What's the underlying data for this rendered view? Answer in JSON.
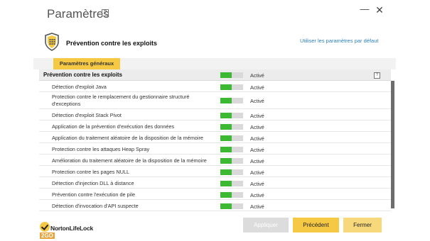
{
  "window": {
    "title": "Paramètres",
    "help": "?",
    "minimize": "—",
    "close": "✕"
  },
  "section": {
    "title": "Prévention contre les exploits",
    "icon": "shield-icon",
    "defaults_link": "Utiliser les paramètres par défaut"
  },
  "tab": {
    "label": "Paramètres généraux"
  },
  "colors": {
    "accent": "#f6c944",
    "toggle_on": "#3cb832",
    "link": "#2f7fb8"
  },
  "list": {
    "header": {
      "label": "Prévention contre les exploits",
      "status": "Activé",
      "enabled": true,
      "help": "?"
    },
    "rows": [
      {
        "label": "Détection d'exploit Java",
        "status": "Activé",
        "enabled": true
      },
      {
        "label": "Protection contre le remplacement du gestionnaire structuré d'exceptions",
        "status": "Activé",
        "enabled": true
      },
      {
        "label": "Détection d'exploit Stack Pivot",
        "status": "Activé",
        "enabled": true
      },
      {
        "label": "Application de la prévention d'exécution des données",
        "status": "Activé",
        "enabled": true
      },
      {
        "label": "Application du traitement aléatoire de la disposition de la mémoire",
        "status": "Activé",
        "enabled": true
      },
      {
        "label": "Protection contre les attaques Heap Spray",
        "status": "Activé",
        "enabled": true
      },
      {
        "label": "Amélioration du traitement aléatoire de la disposition de la mémoire",
        "status": "Activé",
        "enabled": true
      },
      {
        "label": "Protection contre les pages NULL",
        "status": "Activé",
        "enabled": true
      },
      {
        "label": "Détection d'injection DLL à distance",
        "status": "Activé",
        "enabled": true
      },
      {
        "label": "Prévention contre l'exécution de pile",
        "status": "Activé",
        "enabled": true
      },
      {
        "label": "Détection d'invocation d'API suspecte",
        "status": "Activé",
        "enabled": true
      }
    ]
  },
  "footer": {
    "logo": {
      "name": "NortonLifeLock",
      "suffix": "2GO"
    },
    "buttons": {
      "apply": "Appliquer",
      "previous": "Précédent",
      "close": "Fermer"
    }
  }
}
